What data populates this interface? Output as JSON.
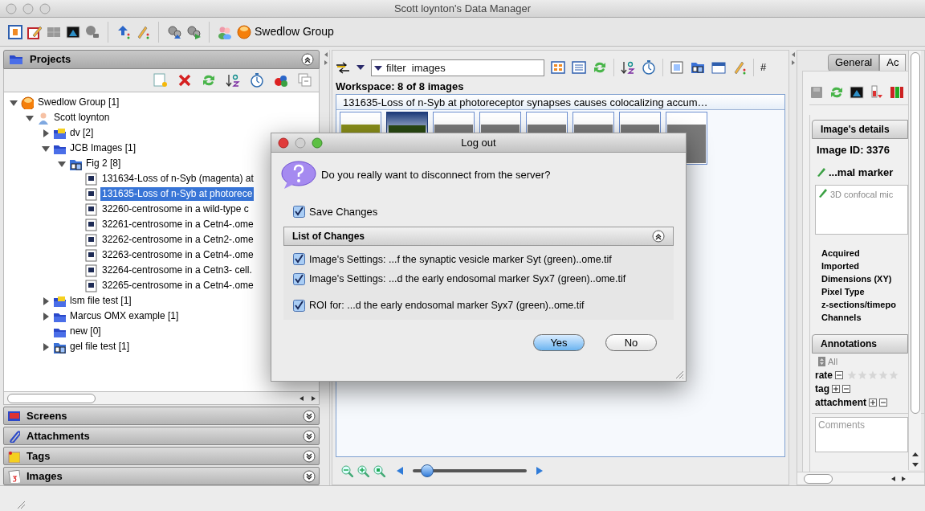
{
  "window": {
    "title": "Scott loynton's Data Manager"
  },
  "toolbar": {
    "group": "Swedlow Group"
  },
  "sidebar": {
    "projects": {
      "title": "Projects",
      "expanded": true
    },
    "tree": [
      {
        "label": "Swedlow Group [1]",
        "kind": "group",
        "expanded": true,
        "selected": false,
        "children": [
          {
            "label": "Scott loynton",
            "kind": "user",
            "expanded": true,
            "selected": false,
            "children": [
              {
                "label": "dv [2]",
                "kind": "tagged",
                "expanded": false,
                "selected": false
              },
              {
                "label": "JCB Images [1]",
                "kind": "project",
                "expanded": true,
                "selected": false,
                "children": [
                  {
                    "label": "Fig 2 [8]",
                    "kind": "dataset",
                    "expanded": true,
                    "selected": false,
                    "children": [
                      {
                        "label": "131634-Loss of n-Syb (magenta) at",
                        "kind": "image",
                        "selected": false
                      },
                      {
                        "label": "131635-Loss of n-Syb at photorece",
                        "kind": "image",
                        "selected": true
                      },
                      {
                        "label": "32260-centrosome in a wild-type c",
                        "kind": "image",
                        "selected": false
                      },
                      {
                        "label": "32261-centrosome in a Cetn4-.ome",
                        "kind": "image",
                        "selected": false
                      },
                      {
                        "label": "32262-centrosome in a Cetn2-.ome",
                        "kind": "image",
                        "selected": false
                      },
                      {
                        "label": "32263-centrosome in a Cetn4-.ome",
                        "kind": "image",
                        "selected": false
                      },
                      {
                        "label": "32264-centrosome in a Cetn3- cell.",
                        "kind": "image",
                        "selected": false
                      },
                      {
                        "label": "32265-centrosome in a Cetn4-.ome",
                        "kind": "image",
                        "selected": false
                      }
                    ]
                  }
                ]
              },
              {
                "label": "lsm file test [1]",
                "kind": "tagged",
                "expanded": false,
                "selected": false
              },
              {
                "label": "Marcus OMX example [1]",
                "kind": "project",
                "expanded": false,
                "selected": false
              },
              {
                "label": "new [0]",
                "kind": "project",
                "selected": false
              },
              {
                "label": "gel file test [1]",
                "kind": "dataset",
                "expanded": false,
                "selected": false
              }
            ]
          }
        ]
      }
    ],
    "panels": [
      {
        "title": "Screens",
        "kind": "screens",
        "expanded": false
      },
      {
        "title": "Attachments",
        "kind": "attachments",
        "expanded": false
      },
      {
        "title": "Tags",
        "kind": "tags",
        "expanded": false
      },
      {
        "title": "Images",
        "kind": "images",
        "expanded": false
      }
    ]
  },
  "workspace": {
    "filter": {
      "placeholder": "filter  images"
    },
    "overflow": "#",
    "title": "Workspace: 8 of 8 images",
    "selected_image": "131635-Loss of n-Syb at photoreceptor synapses causes colocalizing accum…",
    "thumbnails": [
      {
        "kind": "fluorescent",
        "selected": false
      },
      {
        "kind": "fluorescent",
        "selected": true
      },
      {
        "kind": "grayscale",
        "selected": false
      },
      {
        "kind": "grayscale",
        "selected": false
      },
      {
        "kind": "grayscale",
        "selected": false
      },
      {
        "kind": "grayscale",
        "selected": false
      },
      {
        "kind": "grayscale",
        "selected": false
      },
      {
        "kind": "grayscale",
        "selected": false
      }
    ],
    "zoom": {
      "level": 0.08
    }
  },
  "inspector": {
    "tabs": [
      {
        "label": "General",
        "selected": true
      },
      {
        "label": "Ac",
        "selected": false
      }
    ],
    "details": {
      "title": "Image's details",
      "image_id": "Image ID: 3376",
      "name": "...mal marker",
      "description": "3D confocal mic",
      "fields": [
        "Acquired",
        "Imported",
        "Dimensions (XY)",
        "Pixel Type",
        "z-sections/timepo",
        "Channels"
      ]
    },
    "annotations": {
      "title": "Annotations",
      "filter": "All",
      "rows": [
        {
          "label": "rate",
          "kind": "rating",
          "stars": 0
        },
        {
          "label": "tag",
          "kind": "list"
        },
        {
          "label": "attachment",
          "kind": "list"
        }
      ],
      "comments": {
        "placeholder": "Comments"
      }
    }
  },
  "dialog": {
    "title": "Log out",
    "message": "Do you really want to disconnect from the server?",
    "save": {
      "label": "Save Changes",
      "checked": true
    },
    "changes": {
      "title": "List of Changes",
      "expanded": true,
      "items": [
        {
          "label": "Image's Settings: ...f the synaptic vesicle marker Syt (green)..ome.tif",
          "kind": "settings",
          "checked": true
        },
        {
          "label": "Image's Settings: ...d the early endosomal marker Syx7 (green)..ome.tif",
          "kind": "settings",
          "checked": true
        },
        {
          "label": "ROI for: ...d the early endosomal marker Syx7 (green)..ome.tif",
          "kind": "roi",
          "checked": true
        }
      ]
    },
    "buttons": [
      {
        "label": "Yes",
        "default": true
      },
      {
        "label": "No",
        "default": false
      }
    ]
  }
}
